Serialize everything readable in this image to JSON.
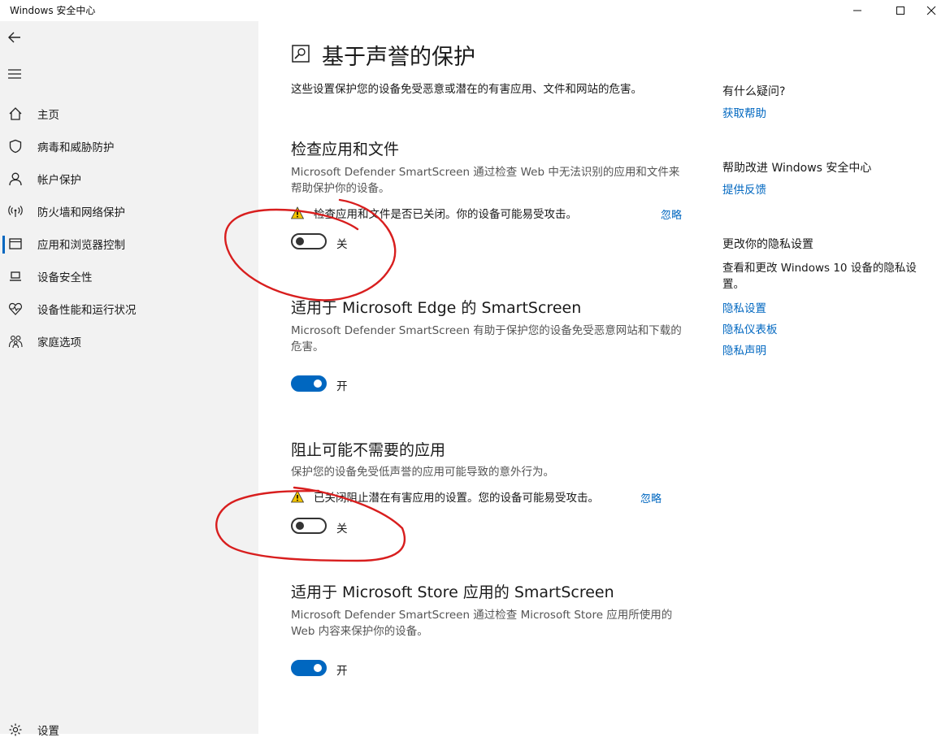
{
  "window": {
    "title": "Windows 安全中心",
    "controls": [
      "minimize-icon",
      "maximize-icon",
      "close-icon"
    ]
  },
  "sidebar": {
    "back_icon": "back-arrow-icon",
    "menu_icon": "hamburger-menu-icon",
    "items": [
      {
        "label": "主页",
        "icon": "home-icon"
      },
      {
        "label": "病毒和威胁防护",
        "icon": "shield-icon"
      },
      {
        "label": "帐户保护",
        "icon": "person-icon"
      },
      {
        "label": "防火墙和网络保护",
        "icon": "wifi-antenna-icon"
      },
      {
        "label": "应用和浏览器控制",
        "icon": "app-window-icon",
        "active": true
      },
      {
        "label": "设备安全性",
        "icon": "laptop-icon"
      },
      {
        "label": "设备性能和运行状况",
        "icon": "heart-pulse-icon"
      },
      {
        "label": "家庭选项",
        "icon": "family-icon"
      }
    ],
    "settings_label": "设置"
  },
  "main": {
    "title": "基于声誉的保护",
    "description": "这些设置保护您的设备免受恶意或潜在的有害应用、文件和网站的危害。",
    "sections": [
      {
        "title": "检查应用和文件",
        "description": "Microsoft Defender SmartScreen 通过检查 Web 中无法识别的应用和文件来帮助保护你的设备。",
        "warning": "检查应用和文件是否已关闭。你的设备可能易受攻击。",
        "ignore": "忽略",
        "toggle_on": false,
        "toggle_label": "关"
      },
      {
        "title": "适用于 Microsoft Edge 的 SmartScreen",
        "description": "Microsoft Defender SmartScreen 有助于保护您的设备免受恶意网站和下载的危害。",
        "toggle_on": true,
        "toggle_label": "开"
      },
      {
        "title": "阻止可能不需要的应用",
        "description": "保护您的设备免受低声誉的应用可能导致的意外行为。",
        "warning": "已关闭阻止潜在有害应用的设置。您的设备可能易受攻击。",
        "ignore": "忽略",
        "toggle_on": false,
        "toggle_label": "关"
      },
      {
        "title": "适用于 Microsoft Store 应用的 SmartScreen",
        "description": "Microsoft Defender SmartScreen 通过检查 Microsoft Store 应用所使用的 Web 内容来保护你的设备。",
        "toggle_on": true,
        "toggle_label": "开"
      }
    ]
  },
  "right": {
    "help": {
      "heading": "有什么疑问?",
      "link": "获取帮助"
    },
    "improve": {
      "heading": "帮助改进 Windows 安全中心",
      "link": "提供反馈"
    },
    "privacy": {
      "heading": "更改你的隐私设置",
      "text": "查看和更改 Windows 10 设备的隐私设置。",
      "links": [
        "隐私设置",
        "隐私仪表板",
        "隐私声明"
      ]
    }
  },
  "colors": {
    "accent": "#0067c0",
    "annotation": "#d81e1e",
    "sidebar_bg": "#f2f2f2"
  }
}
